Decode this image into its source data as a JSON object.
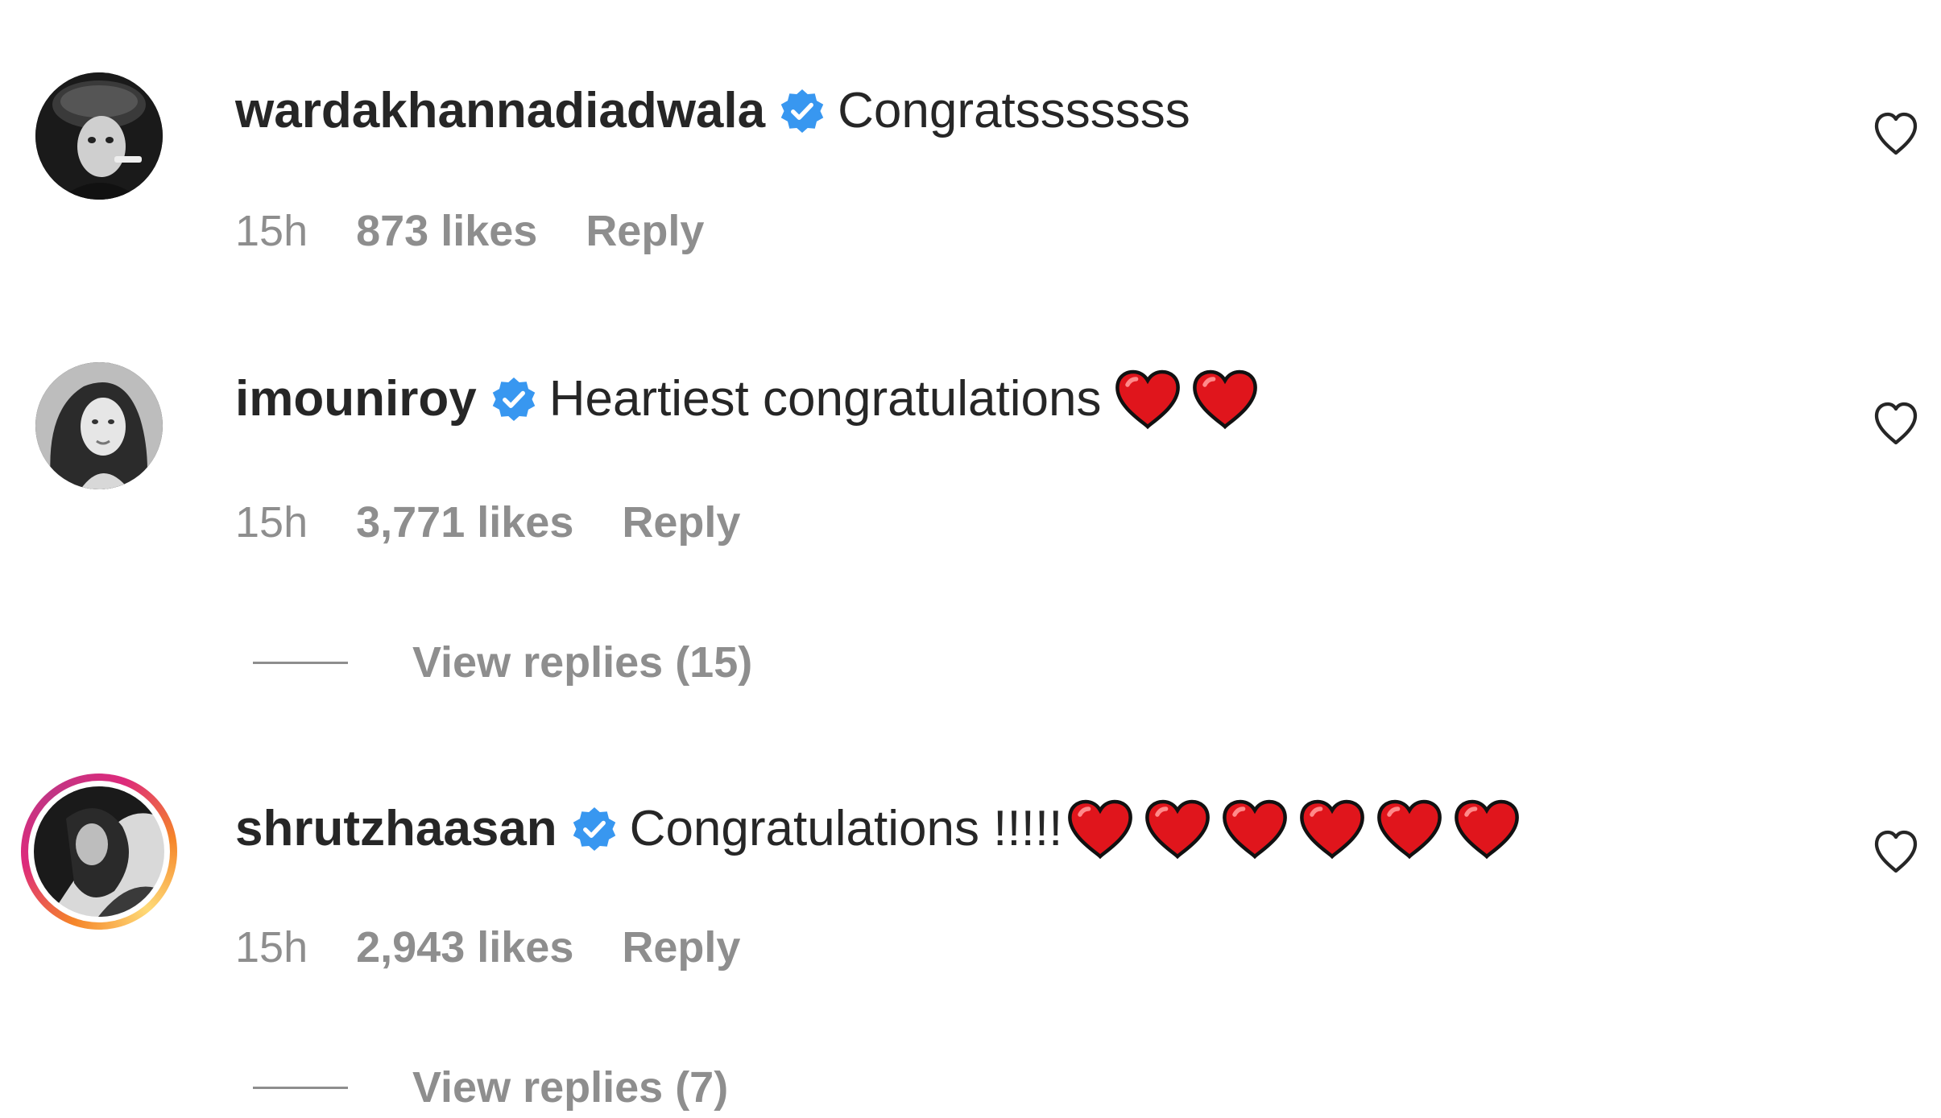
{
  "comments": [
    {
      "username": "wardakhannadiadwala",
      "text": "Congratsssssss",
      "hearts": 0,
      "time": "15h",
      "likes": "873 likes",
      "reply_label": "Reply"
    },
    {
      "username": "imouniroy",
      "text": "Heartiest congratulations",
      "hearts": 2,
      "time": "15h",
      "likes": "3,771 likes",
      "reply_label": "Reply",
      "view_replies": "View replies (15)"
    },
    {
      "username": "shrutzhaasan",
      "text": "Congratulations !!!!!",
      "hearts": 6,
      "time": "15h",
      "likes": "2,943 likes",
      "reply_label": "Reply",
      "view_replies": "View replies (7)",
      "story_ring": true
    }
  ],
  "icons": {
    "verified": "verified-badge-icon",
    "like": "heart-outline-icon",
    "emoji": "red-heart-emoji-icon"
  },
  "colors": {
    "verified_blue": "#3897f0",
    "meta_gray": "#8e8e8e",
    "heart_red": "#e0151c"
  }
}
